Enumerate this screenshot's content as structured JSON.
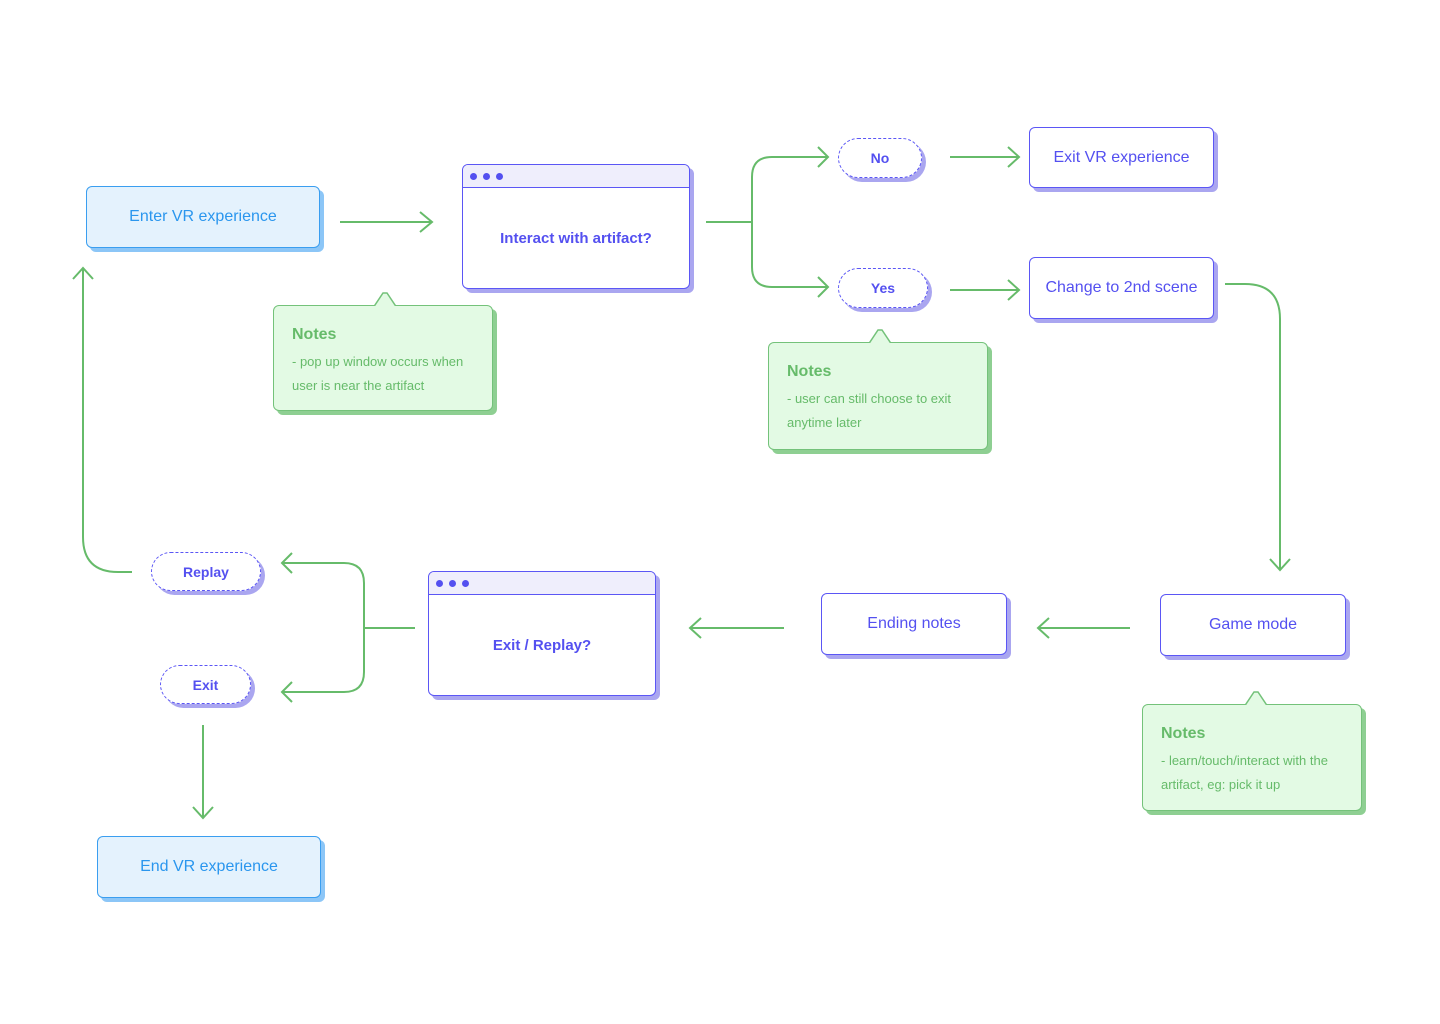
{
  "nodes": {
    "enter": "Enter VR experience",
    "interact": "Interact with artifact?",
    "no": "No",
    "yes": "Yes",
    "exit_vr": "Exit VR experience",
    "change": "Change to 2nd scene",
    "game": "Game mode",
    "ending": "Ending notes",
    "exit_replay": "Exit / Replay?",
    "replay": "Replay",
    "exit": "Exit",
    "end": "End VR experience"
  },
  "notes": [
    {
      "title": "Notes",
      "body": "- pop up window occurs when user is near the artifact"
    },
    {
      "title": "Notes",
      "body": "- user can still choose to exit anytime later"
    },
    {
      "title": "Notes",
      "body": "- learn/touch/interact with the artifact, eg: pick it up"
    }
  ],
  "colors": {
    "connector": "#66bb6a",
    "primary": "#5450f0",
    "start_end": "#2a96ee",
    "note_bg": "#e3fae4"
  }
}
